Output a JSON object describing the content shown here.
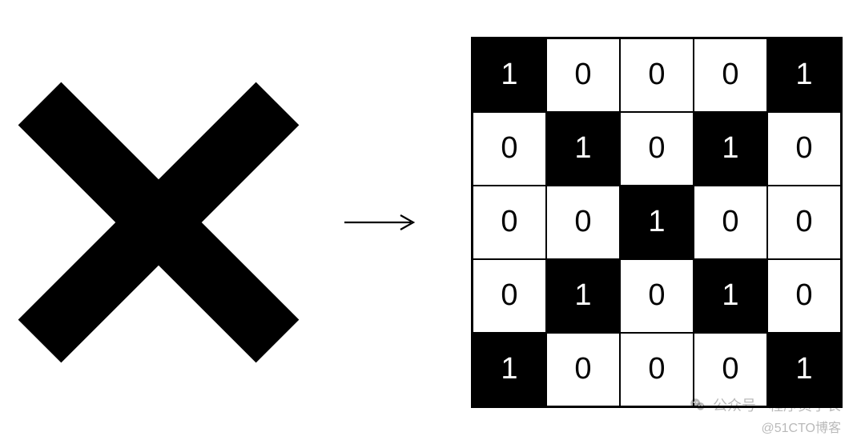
{
  "symbol": {
    "name": "X"
  },
  "arrow": {
    "label": "→"
  },
  "grid": {
    "size": 5,
    "cells": [
      [
        {
          "v": "1",
          "filled": true
        },
        {
          "v": "0",
          "filled": false
        },
        {
          "v": "0",
          "filled": false
        },
        {
          "v": "0",
          "filled": false
        },
        {
          "v": "1",
          "filled": true
        }
      ],
      [
        {
          "v": "0",
          "filled": false
        },
        {
          "v": "1",
          "filled": true
        },
        {
          "v": "0",
          "filled": false
        },
        {
          "v": "1",
          "filled": true
        },
        {
          "v": "0",
          "filled": false
        }
      ],
      [
        {
          "v": "0",
          "filled": false
        },
        {
          "v": "0",
          "filled": false
        },
        {
          "v": "1",
          "filled": true
        },
        {
          "v": "0",
          "filled": false
        },
        {
          "v": "0",
          "filled": false
        }
      ],
      [
        {
          "v": "0",
          "filled": false
        },
        {
          "v": "1",
          "filled": true
        },
        {
          "v": "0",
          "filled": false
        },
        {
          "v": "1",
          "filled": true
        },
        {
          "v": "0",
          "filled": false
        }
      ],
      [
        {
          "v": "1",
          "filled": true
        },
        {
          "v": "0",
          "filled": false
        },
        {
          "v": "0",
          "filled": false
        },
        {
          "v": "0",
          "filled": false
        },
        {
          "v": "1",
          "filled": true
        }
      ]
    ]
  },
  "watermark": {
    "line1": "公众号 · 程序员学长",
    "line2": "@51CTO博客"
  }
}
